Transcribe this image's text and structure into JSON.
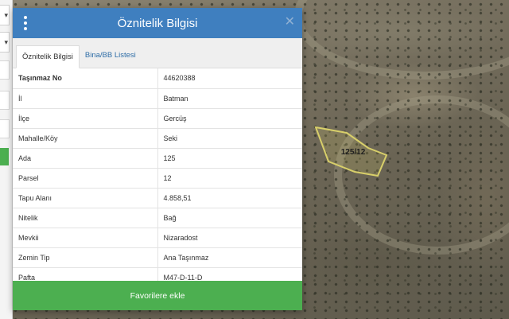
{
  "dialog": {
    "title": "Öznitelik Bilgisi",
    "header_color": "#3f7fbf",
    "menu_icon": "kebab-menu-icon",
    "close_icon": "close-icon",
    "close_glyph": "✕"
  },
  "tabs": [
    {
      "label": "Öznitelik Bilgisi",
      "active": true
    },
    {
      "label": "Bina/BB Listesi",
      "active": false
    }
  ],
  "attributes": [
    {
      "key": "Taşınmaz No",
      "value": "44620388"
    },
    {
      "key": "İl",
      "value": "Batman"
    },
    {
      "key": "İlçe",
      "value": "Gercüş"
    },
    {
      "key": "Mahalle/Köy",
      "value": "Seki"
    },
    {
      "key": "Ada",
      "value": "125"
    },
    {
      "key": "Parsel",
      "value": "12"
    },
    {
      "key": "Tapu Alanı",
      "value": "4.858,51"
    },
    {
      "key": "Nitelik",
      "value": "Bağ"
    },
    {
      "key": "Mevkii",
      "value": "Nizaradost"
    },
    {
      "key": "Zemin Tip",
      "value": "Ana Taşınmaz"
    },
    {
      "key": "Pafta",
      "value": "M47-D-11-D"
    }
  ],
  "favorites_button": {
    "label": "Favorilere ekle",
    "color": "#4caf50"
  },
  "map": {
    "parcel_label": "125/12",
    "parcel_outline_color": "#d8cf6a"
  },
  "left_panel": {
    "select_glyph": "▾"
  }
}
